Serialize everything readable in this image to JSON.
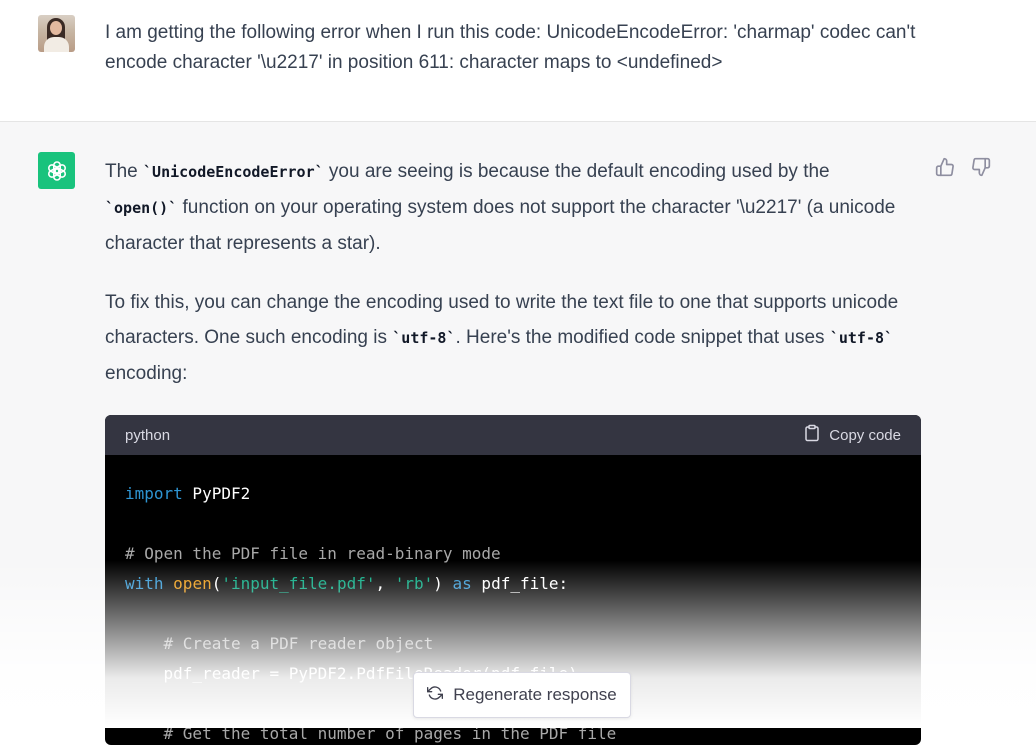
{
  "user_message": {
    "text": "I am getting the following error when I run this code: UnicodeEncodeError: 'charmap' codec can't encode character '\\u2217' in position 611: character maps to <undefined>"
  },
  "assistant_message": {
    "p1": {
      "t1": "The ",
      "c1": "`UnicodeEncodeError`",
      "t2": " you are seeing is because the default encoding used by the ",
      "c2": "`open()`",
      "t3": " function on your operating system does not support the character '\\u2217' (a unicode character that represents a star)."
    },
    "p2": {
      "t1": "To fix this, you can change the encoding used to write the text file to one that supports unicode characters. One such encoding is ",
      "c1": "`utf-8`",
      "t2": ". Here's the modified code snippet that uses ",
      "c2": "`utf-8`",
      "t3": " encoding:"
    }
  },
  "code_block": {
    "language": "python",
    "copy_label": "Copy code",
    "tokens": {
      "import_kw": "import",
      "module": " PyPDF2",
      "comment1": "# Open the PDF file in read-binary mode",
      "with_kw": "with",
      "open_fn": "open",
      "paren_open": "(",
      "file_str": "'input_file.pdf'",
      "comma": ", ",
      "mode_str": "'rb'",
      "paren_close": ") ",
      "as_kw": "as",
      "var_file": " pdf_file:",
      "comment2": "# Create a PDF reader object",
      "reader_line": "pdf_reader = PyPDF2.PdfFileReader(pdf_file)",
      "comment3": "# Get the total number of pages in the PDF file"
    }
  },
  "regenerate": {
    "label": "Regenerate response"
  },
  "colors": {
    "assistant_bg": "#f7f7f8",
    "logo_green": "#19c37d",
    "code_bg": "#000000",
    "code_header_bg": "#343541"
  }
}
